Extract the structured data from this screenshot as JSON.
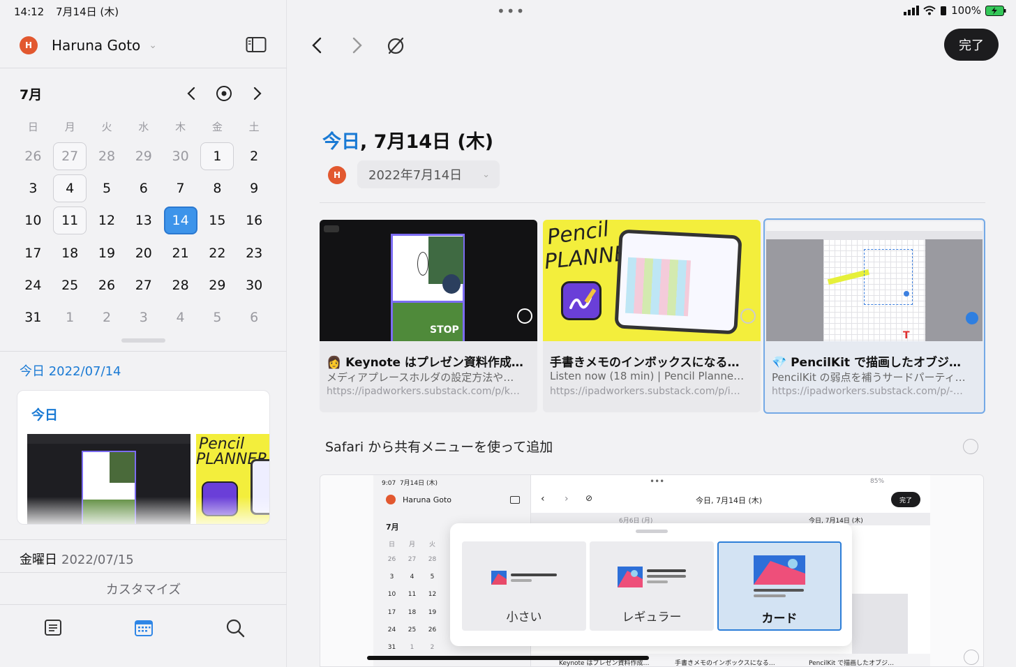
{
  "status": {
    "time": "14:12",
    "date": "7月14日 (木)",
    "battery": "100%"
  },
  "sidebar": {
    "user": {
      "initial": "H",
      "name": "Haruna Goto"
    },
    "calendar": {
      "month": "7月",
      "weekdays": [
        "日",
        "月",
        "火",
        "水",
        "木",
        "金",
        "土"
      ],
      "weeks": [
        [
          "26",
          "27",
          "28",
          "29",
          "30",
          "1",
          "2"
        ],
        [
          "3",
          "4",
          "5",
          "6",
          "7",
          "8",
          "9"
        ],
        [
          "10",
          "11",
          "12",
          "13",
          "14",
          "15",
          "16"
        ],
        [
          "17",
          "18",
          "19",
          "20",
          "21",
          "22",
          "23"
        ],
        [
          "24",
          "25",
          "26",
          "27",
          "28",
          "29",
          "30"
        ],
        [
          "31",
          "1",
          "2",
          "3",
          "4",
          "5",
          "6"
        ]
      ],
      "selected_day": "14"
    },
    "today_section": {
      "header": "今日 2022/07/14",
      "card_label": "今日"
    },
    "next_day": {
      "weekday": "金曜日",
      "date": "2022/07/15"
    },
    "customize_label": "カスタマイズ",
    "tabs": [
      "list-icon",
      "calendar-icon",
      "search-icon"
    ]
  },
  "main": {
    "done_label": "完了",
    "title_today": "今日",
    "title_rest": ", 7月14日 (木)",
    "user_initial": "H",
    "date_picker_value": "2022年7月14日",
    "cards": [
      {
        "emoji": "👩",
        "title": "Keynote はプレゼン資料作成…",
        "desc": "メディアプレースホルダの設定方法や…",
        "url": "https://ipadworkers.substack.com/p/k…"
      },
      {
        "emoji": "",
        "title": "手書きメモのインボックスになる…",
        "desc": "Listen now (18 min) | Pencil Planne…",
        "url": "https://ipadworkers.substack.com/p/i…"
      },
      {
        "emoji": "💎",
        "title": "PencilKit で描画したオブジ…",
        "desc": "PencilKit の弱点を補うサードパーティ…",
        "url": "https://ipadworkers.substack.com/p/-…"
      }
    ],
    "pencil_planner_text": [
      "Pencil",
      "PLANNER"
    ],
    "stop_text": "STOP",
    "safari_note": "Safari から共有メニューを使って追加",
    "embedded": {
      "time": "9:07",
      "date": "7月14日 (木)",
      "battery": "85%",
      "user": "Haruna Goto",
      "month": "7月",
      "title": "今日, 7月14日 (木)",
      "done": "完了",
      "tab_left": "6月6日 (月)",
      "tab_right": "今日, 7月14日 (木)",
      "weekdays": [
        "日",
        "月",
        "火"
      ],
      "rows": [
        [
          "26",
          "27",
          "28"
        ],
        [
          "3",
          "4",
          "5"
        ],
        [
          "10",
          "11",
          "12"
        ],
        [
          "17",
          "18",
          "19"
        ],
        [
          "24",
          "25",
          "26"
        ],
        [
          "31",
          "1",
          "2"
        ]
      ],
      "bottom_titles": [
        "Keynote はプレゼン資料作成…",
        "手書きメモのインボックスになる…",
        "PencilKit で描画したオブジ…"
      ]
    },
    "size_options": [
      {
        "label": "小さい",
        "selected": false
      },
      {
        "label": "レギュラー",
        "selected": false
      },
      {
        "label": "カード",
        "selected": true
      }
    ]
  },
  "colors": {
    "accent_blue": "#1a7ad4",
    "selected_day": "#3d94ea",
    "avatar": "#e2582f",
    "done_button": "#1c1c1e",
    "planner_yellow": "#f3ee3c"
  }
}
